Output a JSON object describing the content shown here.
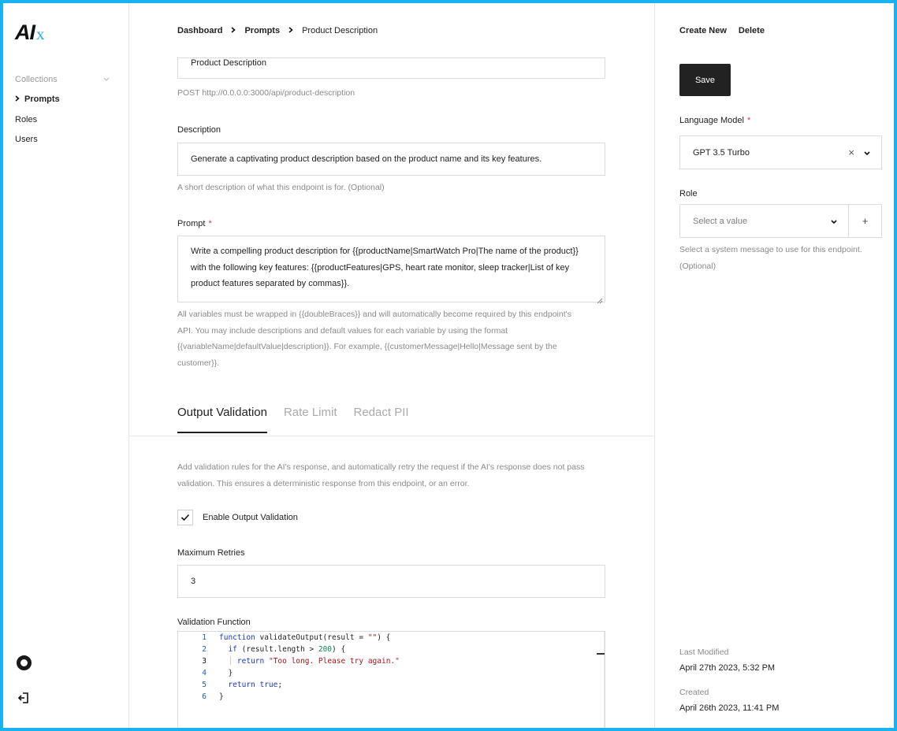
{
  "app": {
    "logo_main": "AI",
    "logo_accent": "x"
  },
  "sidebar": {
    "items": [
      {
        "label": "Collections"
      },
      {
        "label": "Prompts"
      },
      {
        "label": "Roles"
      },
      {
        "label": "Users"
      }
    ],
    "bottom_icons": [
      "settings-circle-icon",
      "logout-icon"
    ]
  },
  "breadcrumb": [
    "Dashboard",
    "Prompts",
    "Product Description"
  ],
  "name_field": {
    "value": "Product Description"
  },
  "endpoint_hint": "POST http://0.0.0.0:3000/api/product-description",
  "description": {
    "label": "Description",
    "value": "Generate a captivating product description based on the product name and its key features.",
    "hint": "A short description of what this endpoint is for. (Optional)"
  },
  "prompt": {
    "label": "Prompt",
    "required_mark": "*",
    "lines": [
      "Write a compelling product description for {{productName|SmartWatch Pro|The name of the product}}",
      "with the following key features: {{productFeatures|GPS, heart rate monitor, sleep tracker|List of key",
      "product features separated by commas}}."
    ],
    "hint_lines": [
      "All variables must be wrapped in {{doubleBraces}} and will automatically become required by this endpoint's",
      "API. You may include descriptions and default values for each variable by using the format",
      "{{variableName|defaultValue|description}}. For example, {{customerMessage|Hello|Message sent by the",
      "customer}}."
    ]
  },
  "tabs": [
    {
      "label": "Output Validation",
      "active": true
    },
    {
      "label": "Rate Limit",
      "active": false
    },
    {
      "label": "Redact PII",
      "active": false
    }
  ],
  "validation": {
    "intro_lines": [
      "Add validation rules for the AI's response, and automatically retry the request if the AI's response does not pass",
      "validation. This ensures a deterministic response from this endpoint, or an error."
    ],
    "enable_label": "Enable Output Validation",
    "enabled": true,
    "max_retries_label": "Maximum Retries",
    "max_retries_value": "3",
    "function_label": "Validation Function",
    "code_line_numbers": [
      "1",
      "2",
      "3",
      "4",
      "5",
      "6"
    ]
  },
  "right": {
    "create_new": "Create New",
    "delete": "Delete",
    "save": "Save",
    "language_model_label": "Language Model",
    "language_model_value": "GPT 3.5 Turbo",
    "role_label": "Role",
    "role_placeholder": "Select a value",
    "role_hint_lines": [
      "Select a system message to use for this endpoint.",
      "(Optional)"
    ],
    "plus": "+",
    "clear": "×",
    "last_modified_label": "Last Modified",
    "last_modified_value": "April 27th 2023, 5:32 PM",
    "created_label": "Created",
    "created_value": "April 26th 2023, 11:41 PM"
  },
  "colors": {
    "accent": "#19b1ee",
    "required": "#e53935",
    "button": "#222222"
  }
}
